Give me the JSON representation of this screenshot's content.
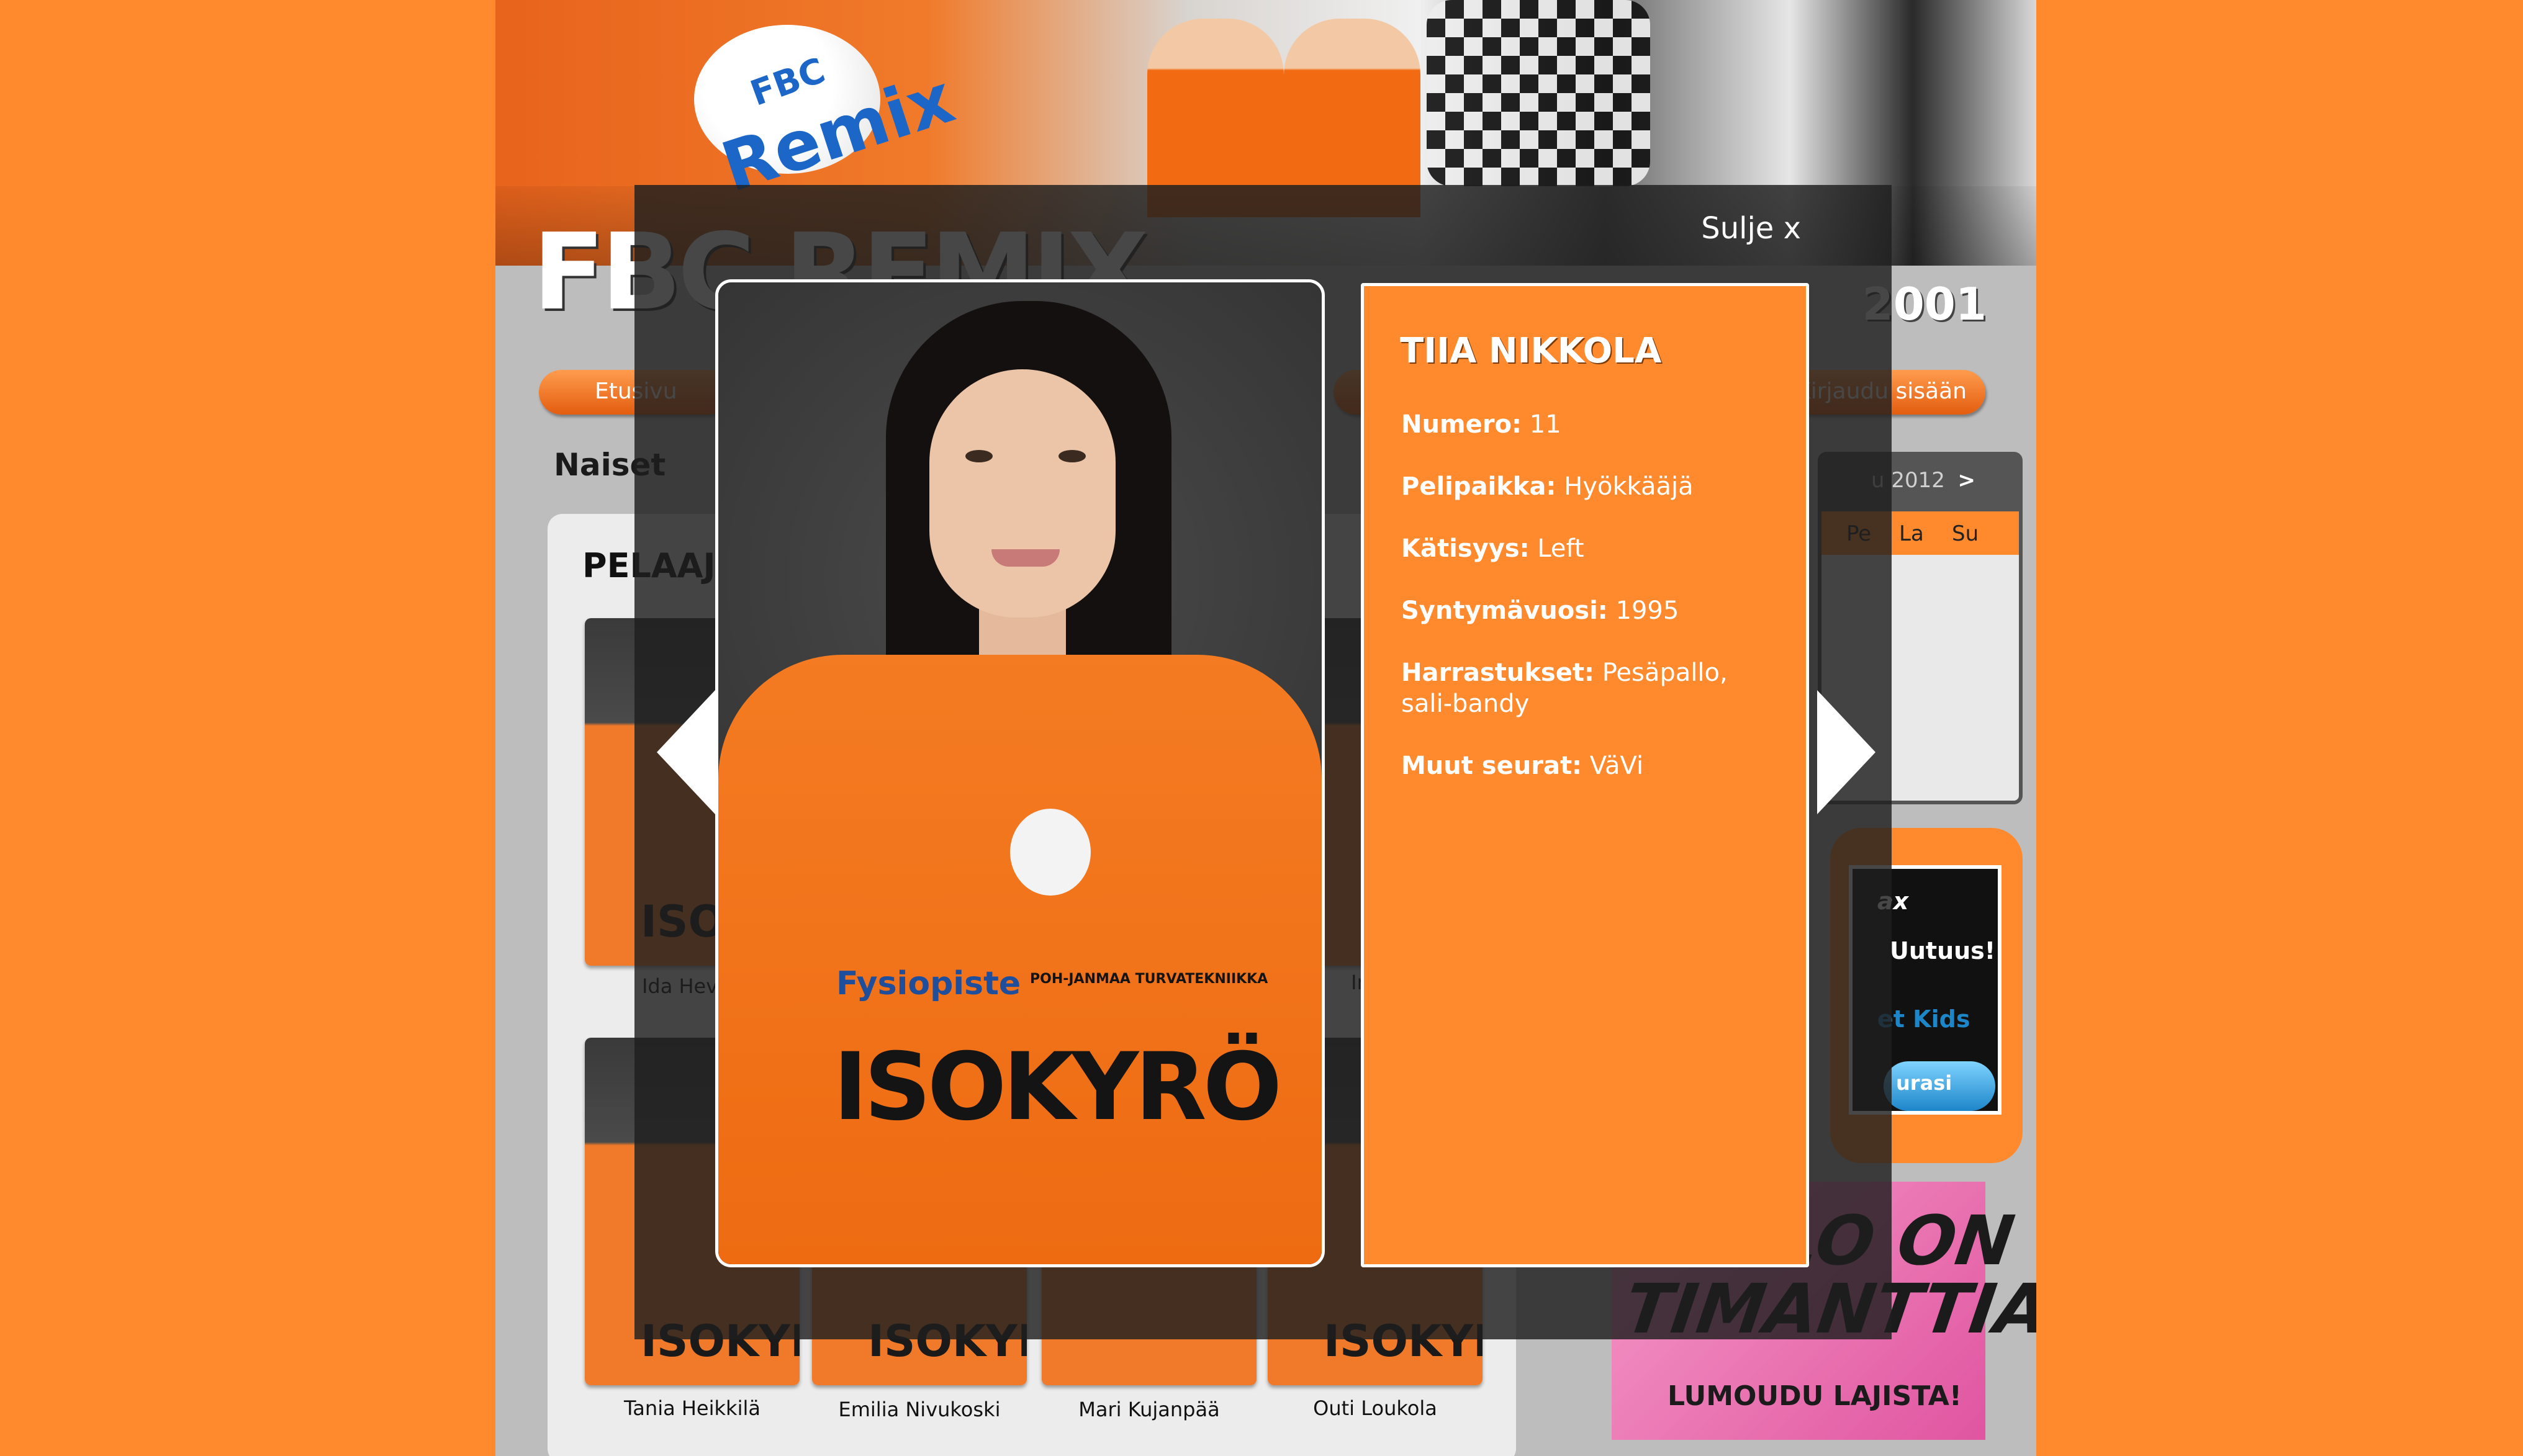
{
  "header": {
    "badge_line1": "FBC",
    "badge_line2": "Remix",
    "logo_text": "FBC REMIX",
    "year_text": "2001"
  },
  "nav": {
    "home_label": "Etusivu",
    "login_label": "Kirjaudu sisään"
  },
  "page": {
    "title": "Naiset",
    "section_heading": "PELAAJAT"
  },
  "players": [
    {
      "name": "Ida Hevon"
    },
    {
      "name": "In"
    },
    {
      "name": "Tania Heikkilä"
    },
    {
      "name": "Emilia Nivukoski"
    },
    {
      "name": "Mari Kujanpää"
    },
    {
      "name": "Outi Loukola"
    }
  ],
  "calendar": {
    "month_label": "u 2012",
    "next_label": ">",
    "days": [
      "Pe",
      "La",
      "Su"
    ]
  },
  "ads": {
    "ad1_lines": [
      "ax",
      "Uutuus!",
      "et Kids",
      "urasi"
    ],
    "ad2_big": "PALLO ON TIMANTTIA",
    "ad2_small": "LUMOUDU LAJISTA!"
  },
  "lightbox": {
    "close_label": "Sulje x",
    "player_name": "TIIA NIKKOLA",
    "fields": [
      {
        "label": "Numero:",
        "value": "11"
      },
      {
        "label": "Pelipaikka:",
        "value": "Hyökkääjä"
      },
      {
        "label": "Kätisyys:",
        "value": "Left"
      },
      {
        "label": "Syntymävuosi:",
        "value": "1995"
      },
      {
        "label": "Harrastukset:",
        "value": "Pesäpallo, sali-bandy"
      },
      {
        "label": "Muut seurat:",
        "value": "VäVi"
      }
    ],
    "shirt": {
      "sponsor": "Fysiopiste",
      "turva": "POH-JANMAA TURVATEKNIIKKA",
      "main": "ISOKYRÖ"
    }
  },
  "colors": {
    "accent": "#ff8a2e",
    "overlay": "#1e1e1e",
    "page_bg": "#bdbdbd"
  }
}
